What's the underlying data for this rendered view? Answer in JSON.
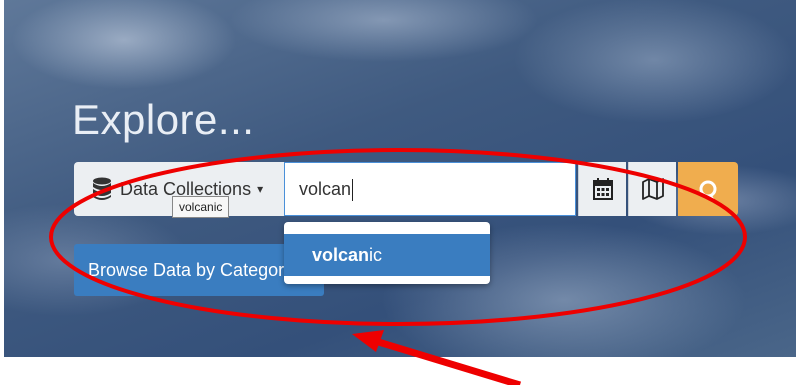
{
  "page": {
    "title": "Explore..."
  },
  "search": {
    "collections_label": "Data Collections",
    "tooltip": "volcanic",
    "query": "volcan",
    "suggestions": [
      {
        "match": "volcan",
        "rest": "ic"
      }
    ],
    "icons": [
      "database-icon",
      "caret-down-icon",
      "calendar-icon",
      "map-icon",
      "search-icon"
    ]
  },
  "browse": {
    "label": "Browse Data by Category"
  },
  "colors": {
    "accent_search": "#f0ad4e",
    "primary_blue": "#3a7dc0",
    "annotation_red": "#ee0000"
  }
}
